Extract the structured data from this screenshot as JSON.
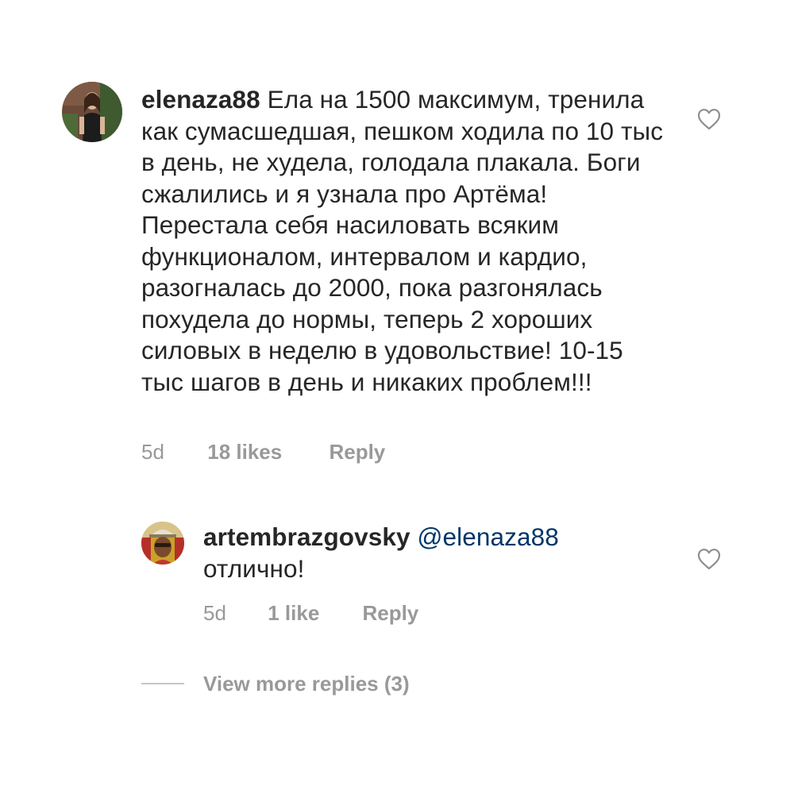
{
  "comments": [
    {
      "username": "elenaza88",
      "text": "Ела на 1500 максимум, тренила как сумасшедшая, пешком ходила по 10 тыс в день, не худела, голодала плакала. Боги сжалились и я узнала про Артёма! Перестала себя насиловать всяким функционалом, интервалом и кардио, разогналась до 2000, пока разгонялась похудела до нормы, теперь 2 хороших силовых в неделю в удовольствие! 10-15 тыс шагов в день и никаких проблем!!!",
      "time": "5d",
      "likes": "18 likes",
      "reply_label": "Reply",
      "like_icon": "heart-outline-icon"
    },
    {
      "username": "artembrazgovsky",
      "mention": "@elenaza88",
      "text": "отлично!",
      "time": "5d",
      "likes": "1 like",
      "reply_label": "Reply",
      "like_icon": "heart-outline-icon"
    }
  ],
  "view_more": {
    "label": "View more replies (3)"
  },
  "colors": {
    "text": "#262626",
    "secondary": "#999999",
    "mention": "#003569",
    "divider": "#c7c7c7"
  }
}
